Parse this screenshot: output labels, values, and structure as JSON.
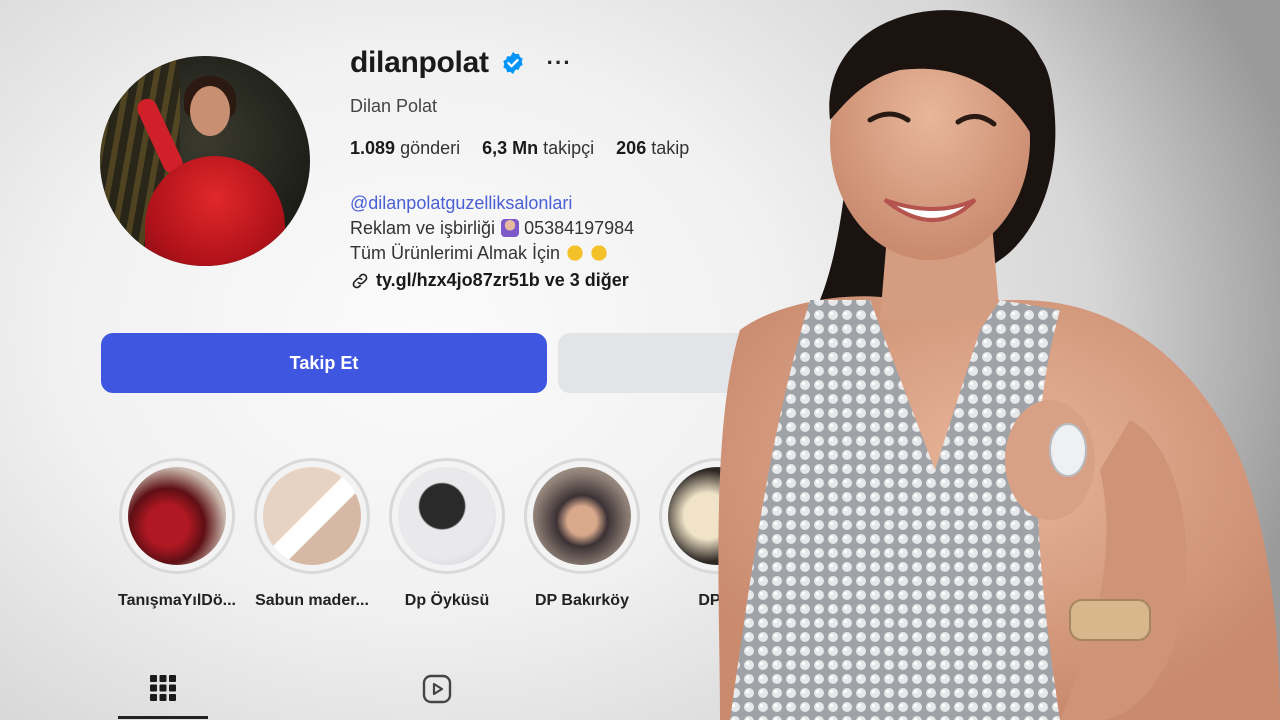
{
  "profile": {
    "username": "dilanpolat",
    "more_label": "···",
    "full_name": "Dilan Polat",
    "stats": {
      "posts_count": "1.089",
      "posts_label": "gönderi",
      "followers_count": "6,3 Mn",
      "followers_label": "takipçi",
      "following_count": "206",
      "following_label": "takip"
    },
    "bio": {
      "mention": "@dilanpolatguzelliksalonlari",
      "line1": "Reklam ve işbirliği",
      "line1_phone": "05384197984",
      "line2": "Tüm Ürünlerimi Almak İçin",
      "link": "ty.gl/hzx4jo87zr51b ve 3 diğer"
    }
  },
  "actions": {
    "follow_label": "Takip Et"
  },
  "highlights": [
    {
      "label": "TanışmaYılDö..."
    },
    {
      "label": "Sabun mader..."
    },
    {
      "label": "Dp Öyküsü"
    },
    {
      "label": "DP Bakırköy"
    },
    {
      "label": "DP A"
    }
  ],
  "tabs": {
    "posts_icon": "grid-icon",
    "reels_icon": "reels-icon"
  },
  "colors": {
    "follow_button": "#3f57e0",
    "mention": "#4a5fd4",
    "verified": "#0095f6"
  }
}
